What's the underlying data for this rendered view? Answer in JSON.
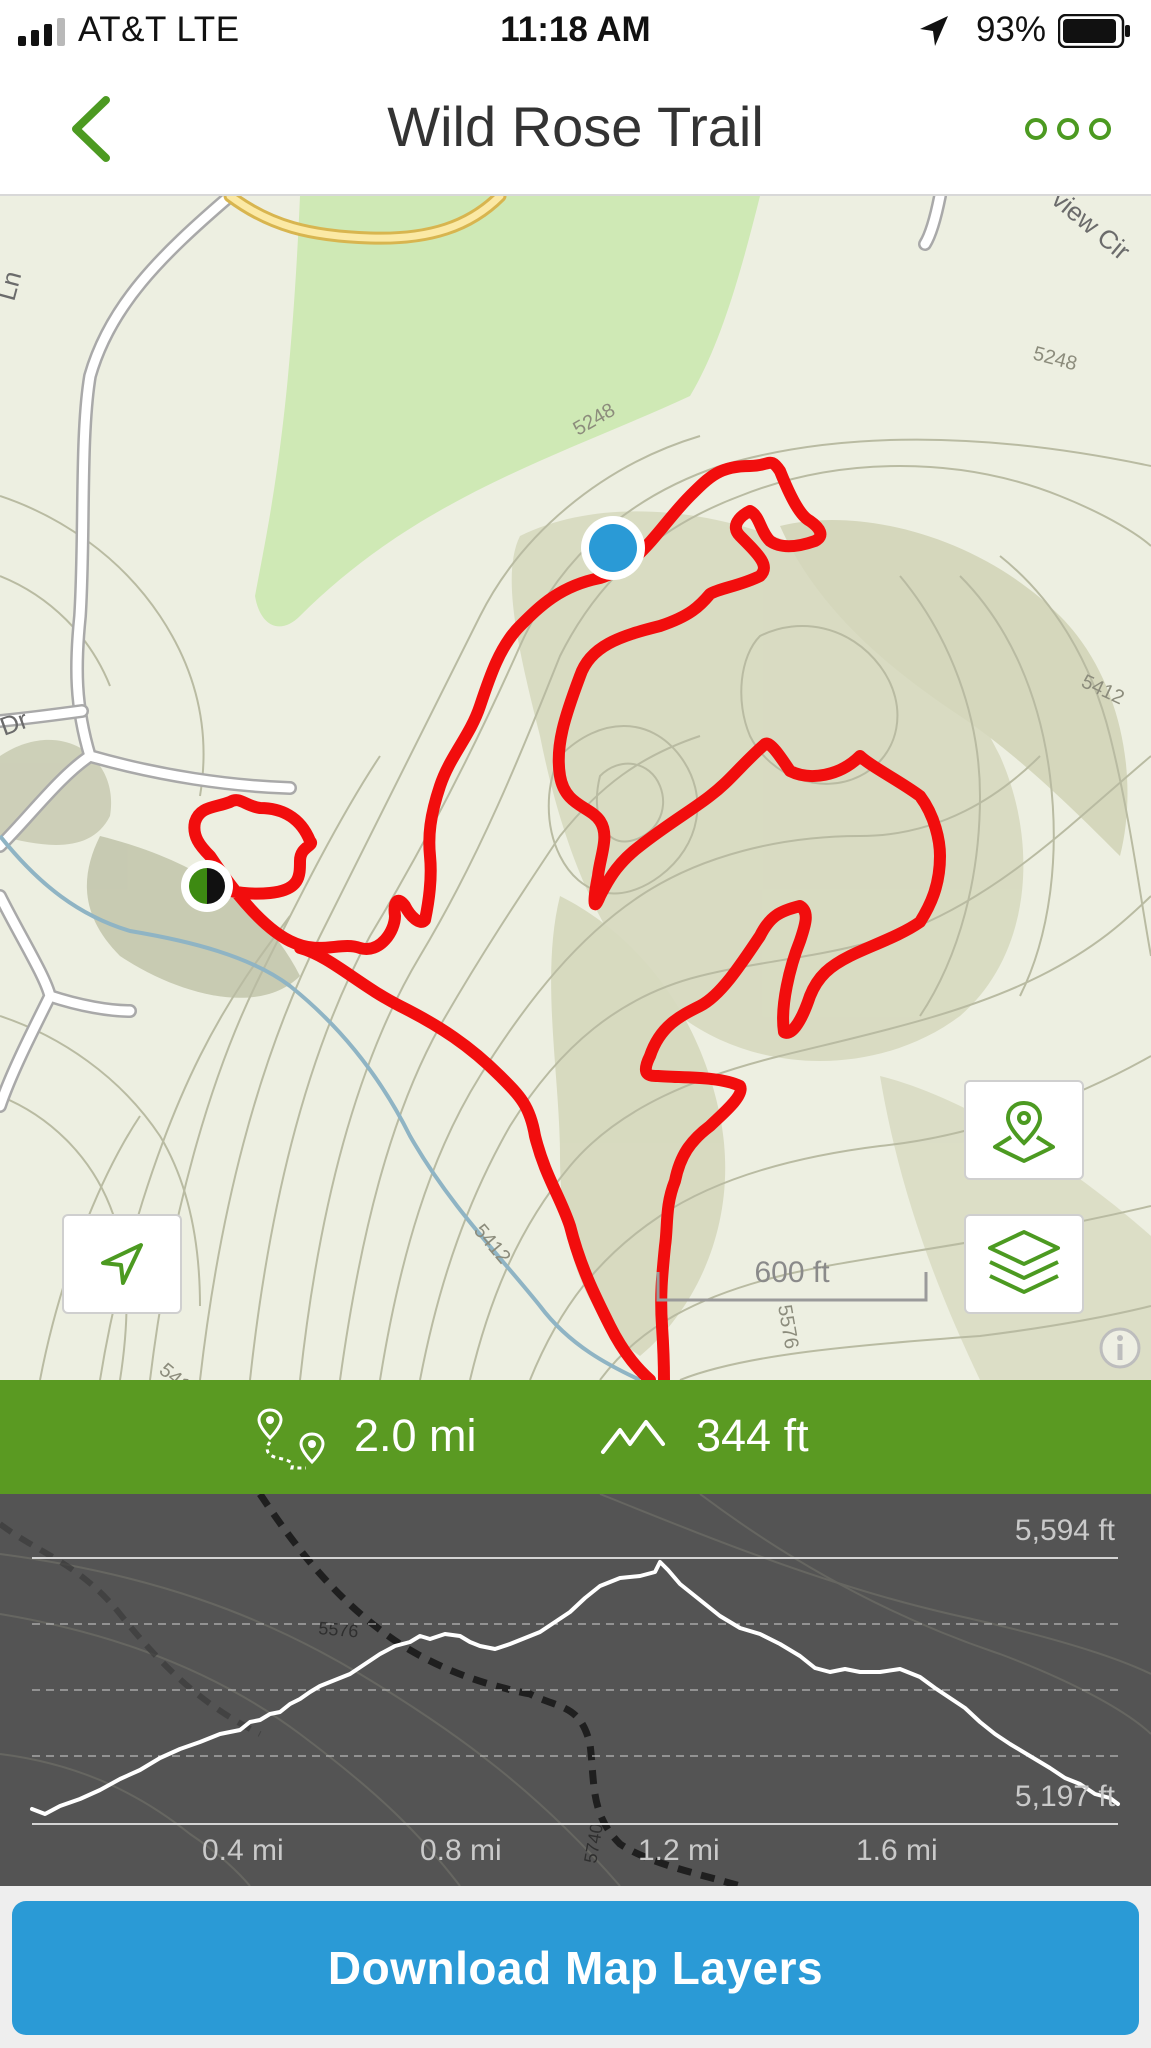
{
  "status_bar": {
    "carrier": "AT&T   LTE",
    "time": "11:18 AM",
    "battery_percent": "93%"
  },
  "nav": {
    "title": "Wild Rose Trail"
  },
  "map": {
    "scale_label": "600 ft",
    "contour_labels": [
      "5248",
      "5248",
      "5412",
      "5412",
      "5412",
      "5576",
      "5576",
      "5740"
    ],
    "street_labels": [
      "Ln",
      "Dr",
      "view Cir"
    ]
  },
  "stats": {
    "distance": "2.0 mi",
    "elevation_gain": "344 ft"
  },
  "elevation_profile": {
    "max_label": "5,594 ft",
    "min_label": "5,197 ft",
    "x_labels": [
      "0.4 mi",
      "0.8 mi",
      "1.2 mi",
      "1.6 mi"
    ]
  },
  "footer": {
    "download_label": "Download Map Layers"
  },
  "colors": {
    "accent_green": "#5a9a22",
    "trail_red": "#f20d0d",
    "button_blue": "#2a9ad6",
    "location_blue": "#2a9ad6"
  },
  "icons": [
    "signal-icon",
    "location-arrow-icon",
    "battery-icon",
    "back-chevron-icon",
    "more-icon",
    "locate-me-icon",
    "trail-pin-icon",
    "layers-icon",
    "info-icon",
    "route-icon",
    "elevation-icon"
  ]
}
